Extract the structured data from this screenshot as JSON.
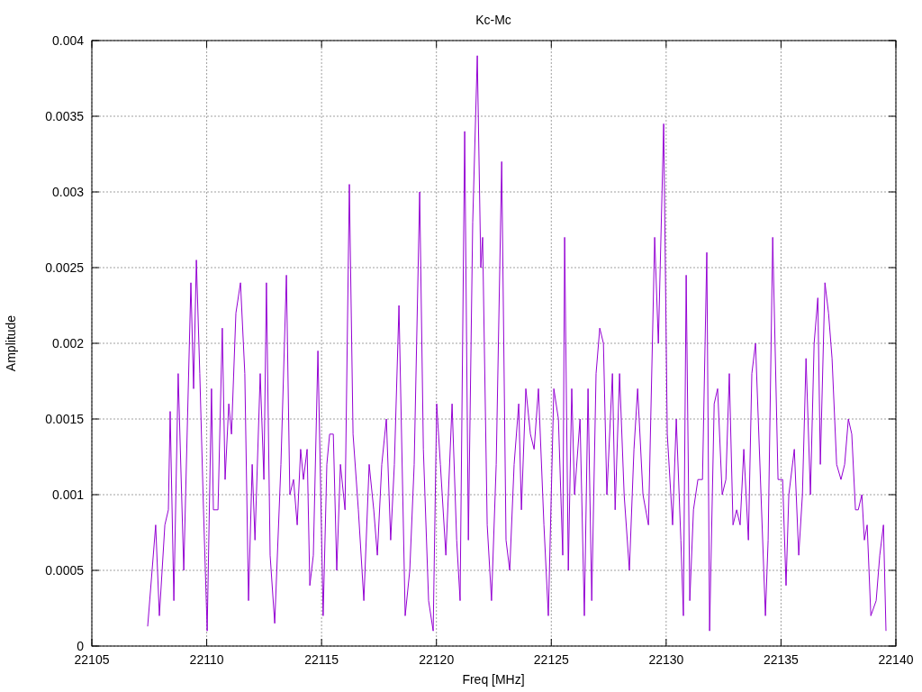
{
  "chart_data": {
    "type": "line",
    "grid": true,
    "title": "Kc-Mc",
    "xlabel": "Freq [MHz]",
    "ylabel": "Amplitude",
    "xlim": [
      22105,
      22140
    ],
    "ylim": [
      0,
      0.004
    ],
    "xticks": [
      22105,
      22110,
      22115,
      22120,
      22125,
      22130,
      22135,
      22140
    ],
    "yticks": [
      0,
      0.0005,
      0.001,
      0.0015,
      0.002,
      0.0025,
      0.003,
      0.0035,
      0.004
    ],
    "x": [
      22107.43,
      22107.78,
      22107.94,
      22108.18,
      22108.33,
      22108.41,
      22108.57,
      22108.76,
      22109.0,
      22109.31,
      22109.43,
      22109.55,
      22109.7,
      22109.86,
      22110.02,
      22110.21,
      22110.29,
      22110.49,
      22110.68,
      22110.8,
      22110.96,
      22111.08,
      22111.27,
      22111.47,
      22111.66,
      22111.82,
      22111.98,
      22112.1,
      22112.33,
      22112.49,
      22112.6,
      22112.76,
      22112.96,
      22113.23,
      22113.47,
      22113.62,
      22113.78,
      22113.94,
      22114.09,
      22114.21,
      22114.37,
      22114.49,
      22114.64,
      22114.84,
      22115.07,
      22115.23,
      22115.35,
      22115.51,
      22115.66,
      22115.82,
      22116.02,
      22116.21,
      22116.37,
      22116.6,
      22116.84,
      22117.07,
      22117.27,
      22117.43,
      22117.62,
      22117.82,
      22118.01,
      22118.17,
      22118.37,
      22118.64,
      22118.84,
      22119.03,
      22119.27,
      22119.43,
      22119.66,
      22119.86,
      22120.01,
      22120.17,
      22120.41,
      22120.68,
      22120.88,
      22121.03,
      22121.23,
      22121.39,
      22121.58,
      22121.78,
      22121.93,
      22122.01,
      22122.21,
      22122.4,
      22122.6,
      22122.84,
      22123.03,
      22123.19,
      22123.38,
      22123.58,
      22123.7,
      22123.89,
      22124.09,
      22124.25,
      22124.44,
      22124.68,
      22124.87,
      22125.11,
      22125.31,
      22125.5,
      22125.58,
      22125.74,
      22125.89,
      22126.01,
      22126.25,
      22126.44,
      22126.6,
      22126.76,
      22126.95,
      22127.11,
      22127.27,
      22127.42,
      22127.66,
      22127.78,
      22127.97,
      22128.17,
      22128.4,
      22128.6,
      22128.76,
      22128.99,
      22129.23,
      22129.5,
      22129.66,
      22129.89,
      22130.05,
      22130.28,
      22130.44,
      22130.64,
      22130.75,
      22130.87,
      22131.03,
      22131.19,
      22131.38,
      22131.58,
      22131.77,
      22131.89,
      22132.09,
      22132.24,
      22132.44,
      22132.6,
      22132.75,
      22132.91,
      22133.07,
      22133.22,
      22133.38,
      22133.58,
      22133.73,
      22133.89,
      22134.13,
      22134.32,
      22134.44,
      22134.64,
      22134.87,
      22135.07,
      22135.22,
      22135.34,
      22135.58,
      22135.77,
      22135.93,
      22136.09,
      22136.28,
      22136.44,
      22136.6,
      22136.71,
      22136.91,
      22137.07,
      22137.22,
      22137.42,
      22137.61,
      22137.77,
      22137.93,
      22138.08,
      22138.24,
      22138.36,
      22138.52,
      22138.63,
      22138.75,
      22138.91,
      22139.14,
      22139.3,
      22139.46,
      22139.57
    ],
    "series": [
      {
        "color": "#9400d3",
        "values": [
          0.00013,
          0.0008,
          0.0002,
          0.0008,
          0.0009,
          0.00155,
          0.0003,
          0.0018,
          0.0005,
          0.0024,
          0.0017,
          0.00255,
          0.0018,
          0.0009,
          0.0001,
          0.0017,
          0.0009,
          0.0009,
          0.0021,
          0.0011,
          0.0016,
          0.0014,
          0.0022,
          0.0024,
          0.0018,
          0.0003,
          0.0012,
          0.0007,
          0.0018,
          0.0011,
          0.0024,
          0.0006,
          0.00015,
          0.0012,
          0.00245,
          0.001,
          0.0011,
          0.0008,
          0.0013,
          0.0011,
          0.0013,
          0.0004,
          0.0006,
          0.00195,
          0.0002,
          0.0012,
          0.0014,
          0.0014,
          0.0005,
          0.0012,
          0.0009,
          0.00305,
          0.0014,
          0.0009,
          0.0003,
          0.0012,
          0.0009,
          0.0006,
          0.0012,
          0.0015,
          0.0007,
          0.0012,
          0.00225,
          0.0002,
          0.0005,
          0.0012,
          0.003,
          0.0013,
          0.0003,
          0.0001,
          0.0016,
          0.0012,
          0.0006,
          0.0016,
          0.0007,
          0.0003,
          0.0034,
          0.0007,
          0.0028,
          0.0039,
          0.0025,
          0.0027,
          0.0008,
          0.0003,
          0.0012,
          0.0032,
          0.0007,
          0.0005,
          0.0012,
          0.0016,
          0.0009,
          0.0017,
          0.0014,
          0.0013,
          0.0017,
          0.0008,
          0.0002,
          0.0017,
          0.0015,
          0.0006,
          0.0027,
          0.0005,
          0.0017,
          0.001,
          0.0015,
          0.0002,
          0.0017,
          0.0003,
          0.0018,
          0.0021,
          0.002,
          0.001,
          0.0018,
          0.0009,
          0.0018,
          0.001,
          0.0005,
          0.0013,
          0.0017,
          0.001,
          0.0008,
          0.0027,
          0.002,
          0.00345,
          0.0014,
          0.0008,
          0.0015,
          0.0007,
          0.0002,
          0.00245,
          0.0003,
          0.0009,
          0.0011,
          0.0011,
          0.0026,
          0.0001,
          0.0016,
          0.0017,
          0.001,
          0.0011,
          0.0018,
          0.0008,
          0.0009,
          0.0008,
          0.0013,
          0.0007,
          0.0018,
          0.002,
          0.001,
          0.0002,
          0.0007,
          0.0027,
          0.0011,
          0.0011,
          0.0004,
          0.001,
          0.0013,
          0.0006,
          0.001,
          0.0019,
          0.001,
          0.002,
          0.0023,
          0.0012,
          0.0024,
          0.0022,
          0.0019,
          0.0012,
          0.0011,
          0.0012,
          0.0015,
          0.0014,
          0.0009,
          0.0009,
          0.001,
          0.0007,
          0.0008,
          0.0002,
          0.0003,
          0.0006,
          0.0008,
          0.0001
        ]
      }
    ]
  }
}
